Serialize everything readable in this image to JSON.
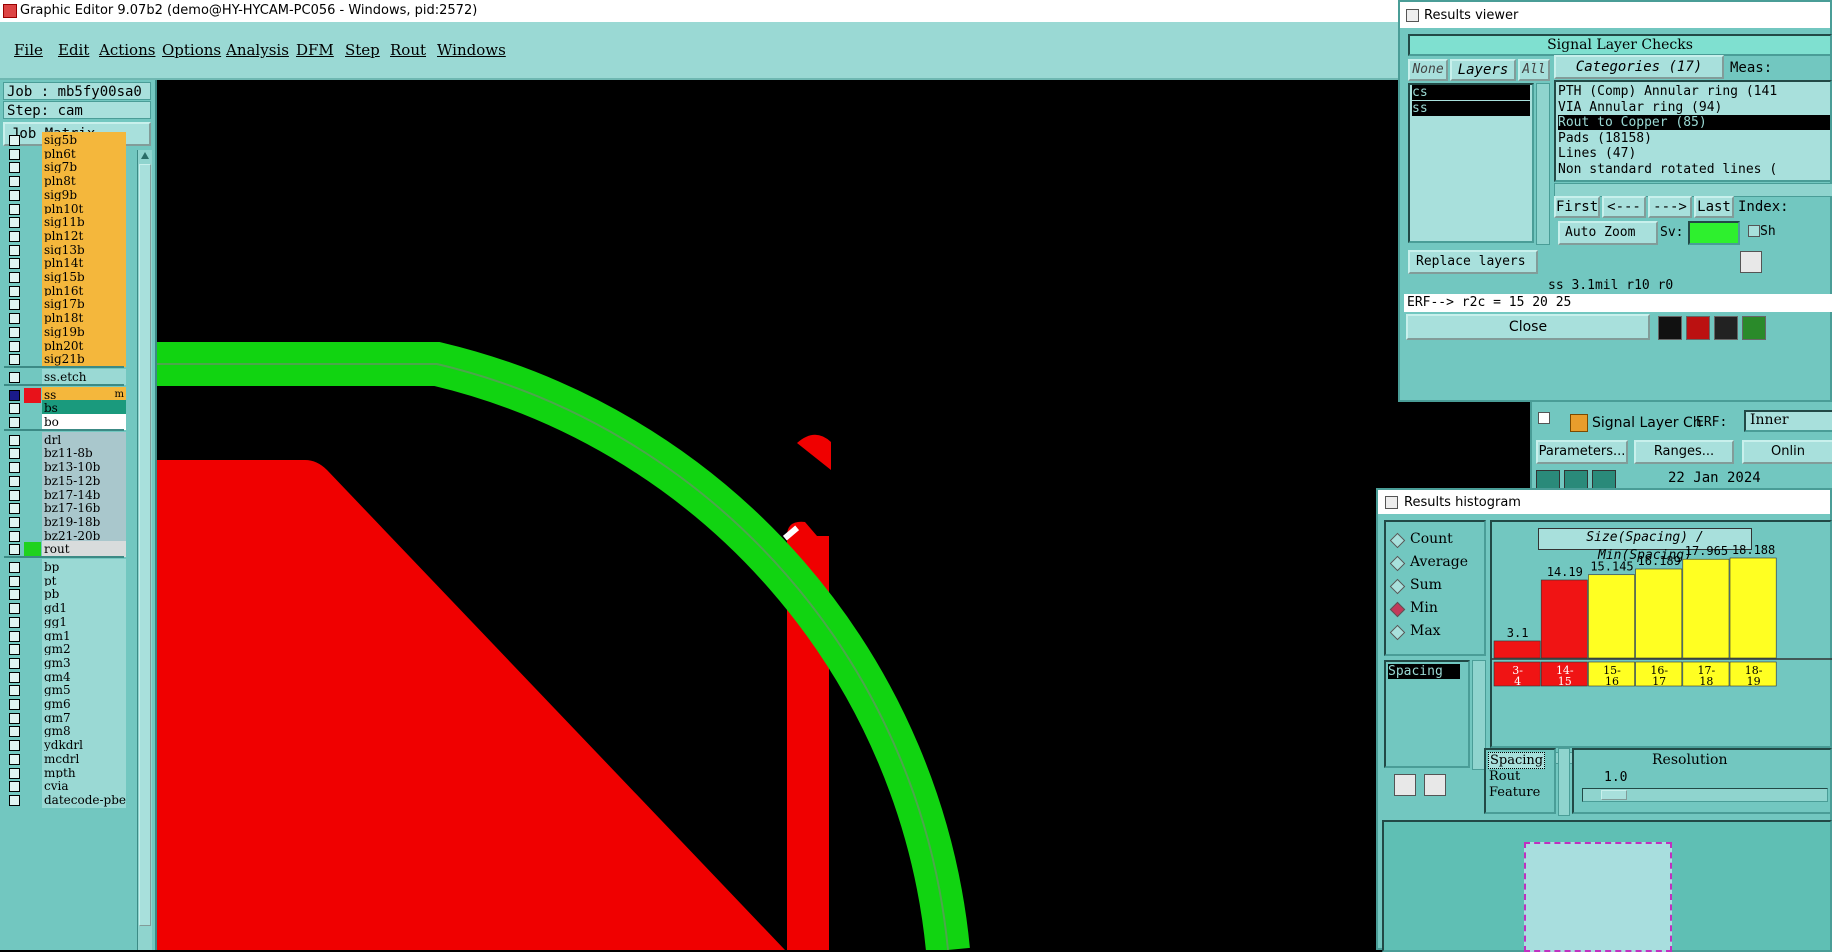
{
  "window": {
    "title": "Graphic Editor 9.07b2 (demo@HY-HYCAM-PC056 - Windows, pid:2572)"
  },
  "menu": [
    "File",
    "Edit",
    "Actions",
    "Options",
    "Analysis",
    "DFM",
    "Step",
    "Rout",
    "Windows"
  ],
  "job": {
    "job_label": "Job : mb5fy00sa0",
    "step_label": "Step: cam",
    "matrix_button": "Job Matrix ..."
  },
  "layers_group1": [
    {
      "name": "sig5b",
      "style": "sig"
    },
    {
      "name": "pln6t",
      "style": "sig"
    },
    {
      "name": "sig7b",
      "style": "sig"
    },
    {
      "name": "pln8t",
      "style": "sig"
    },
    {
      "name": "sig9b",
      "style": "sig"
    },
    {
      "name": "pln10t",
      "style": "sig"
    },
    {
      "name": "sig11b",
      "style": "sig"
    },
    {
      "name": "pln12t",
      "style": "sig"
    },
    {
      "name": "sig13b",
      "style": "sig"
    },
    {
      "name": "pln14t",
      "style": "sig"
    },
    {
      "name": "sig15b",
      "style": "sig"
    },
    {
      "name": "pln16t",
      "style": "sig"
    },
    {
      "name": "sig17b",
      "style": "sig"
    },
    {
      "name": "pln18t",
      "style": "sig"
    },
    {
      "name": "sig19b",
      "style": "sig"
    },
    {
      "name": "pln20t",
      "style": "sig"
    },
    {
      "name": "sig21b",
      "style": "sig"
    }
  ],
  "layers_group2": [
    {
      "name": "ss.etch",
      "style": "blue"
    }
  ],
  "layers_group3": [
    {
      "name": "ss",
      "style": "sig",
      "swatch": "#e8121a",
      "active": true,
      "suffix": "m"
    },
    {
      "name": "bs",
      "style": "teal"
    },
    {
      "name": "bo",
      "style": "white"
    }
  ],
  "layers_group4": [
    {
      "name": "drl",
      "style": "gray"
    },
    {
      "name": "bz11-8b",
      "style": "gray"
    },
    {
      "name": "bz13-10b",
      "style": "gray"
    },
    {
      "name": "bz15-12b",
      "style": "gray"
    },
    {
      "name": "bz17-14b",
      "style": "gray"
    },
    {
      "name": "bz17-16b",
      "style": "gray"
    },
    {
      "name": "bz19-18b",
      "style": "gray"
    },
    {
      "name": "bz21-20b",
      "style": "gray"
    },
    {
      "name": "rout",
      "style": "ltgray",
      "swatch": "#1fd21f"
    }
  ],
  "layers_group5": [
    {
      "name": "bp",
      "style": "blue"
    },
    {
      "name": "pt",
      "style": "blue"
    },
    {
      "name": "pb",
      "style": "blue"
    },
    {
      "name": "gd1",
      "style": "blue"
    },
    {
      "name": "gg1",
      "style": "blue"
    },
    {
      "name": "gm1",
      "style": "blue"
    },
    {
      "name": "gm2",
      "style": "blue"
    },
    {
      "name": "gm3",
      "style": "blue"
    },
    {
      "name": "gm4",
      "style": "blue"
    },
    {
      "name": "gm5",
      "style": "blue"
    },
    {
      "name": "gm6",
      "style": "blue"
    },
    {
      "name": "gm7",
      "style": "blue"
    },
    {
      "name": "gm8",
      "style": "blue"
    },
    {
      "name": "ydkdrl",
      "style": "blue"
    },
    {
      "name": "mcdrl",
      "style": "blue"
    },
    {
      "name": "mpth",
      "style": "blue"
    },
    {
      "name": "cvia",
      "style": "blue"
    },
    {
      "name": "datecode-pbe",
      "style": "blue"
    }
  ],
  "results_viewer": {
    "title": "Results viewer",
    "header": "Signal Layer Checks",
    "btn_none": "None",
    "btn_layers": "Layers",
    "btn_all": "All",
    "layers": [
      "cs",
      "ss"
    ],
    "categories_header": "Categories (17)",
    "meas_label": "Meas:",
    "categories": [
      {
        "text": "PTH (Comp) Annular ring (141",
        "selected": false
      },
      {
        "text": "VIA Annular ring (94)",
        "selected": false
      },
      {
        "text": "Rout to Copper (85)",
        "selected": true
      },
      {
        "text": "Pads (18158)",
        "selected": false
      },
      {
        "text": "Lines (47)",
        "selected": false
      },
      {
        "text": "Non standard rotated lines (",
        "selected": false
      }
    ],
    "btn_first": "First",
    "btn_prev": "<---",
    "btn_next": "--->",
    "btn_last": "Last",
    "index_label": "Index:",
    "auto_zoom": "Auto Zoom",
    "sv_label": "Sv:",
    "sh_label": "Sh",
    "replace_layers": "Replace layers",
    "measure_line": "ss 3.1mil  r10  r0",
    "erf_line": "ERF--> r2c = 15 20 25",
    "close": "Close"
  },
  "signal_check": {
    "title": "Signal Layer Ch",
    "erf_label": "ERF:",
    "erf_value": "Inner",
    "parameters": "Parameters...",
    "ranges": "Ranges...",
    "online": "Onlin",
    "date": "22 Jan 2024"
  },
  "histogram": {
    "title": "Results histogram",
    "modes": [
      {
        "label": "Count",
        "on": false
      },
      {
        "label": "Average",
        "on": false
      },
      {
        "label": "Sum",
        "on": false
      },
      {
        "label": "Min",
        "on": true
      },
      {
        "label": "Max",
        "on": false
      }
    ],
    "chart_title": "Size(Spacing) / Min(Spacing)",
    "list_selected": "Spacing",
    "fields": [
      "Spacing",
      "Rout",
      "Feature"
    ],
    "resolution_label": "Resolution",
    "resolution_value": "1.0"
  },
  "chart_data": {
    "type": "bar",
    "title": "Size(Spacing) / Min(Spacing)",
    "categories": [
      "3-4",
      "14-15",
      "15-16",
      "16-17",
      "17-18",
      "18-19"
    ],
    "values": [
      3.1,
      14.19,
      15.145,
      16.189,
      17.965,
      18.188
    ],
    "value_labels": [
      "3.1",
      "14.19",
      "15.145",
      "16.189",
      "17.965",
      "18.188"
    ],
    "category_labels": [
      [
        "3-",
        "4"
      ],
      [
        "14-",
        "15"
      ],
      [
        "15-",
        "16"
      ],
      [
        "16-",
        "17"
      ],
      [
        "17-",
        "18"
      ],
      [
        "18-",
        "19"
      ]
    ],
    "colors": [
      "#f01414",
      "#f01414",
      "#ffff22",
      "#ffff22",
      "#ffff22",
      "#ffff22"
    ]
  },
  "colors": {
    "copper": "#f00000",
    "rout": "#11d411",
    "panel": "#72c7c0"
  }
}
